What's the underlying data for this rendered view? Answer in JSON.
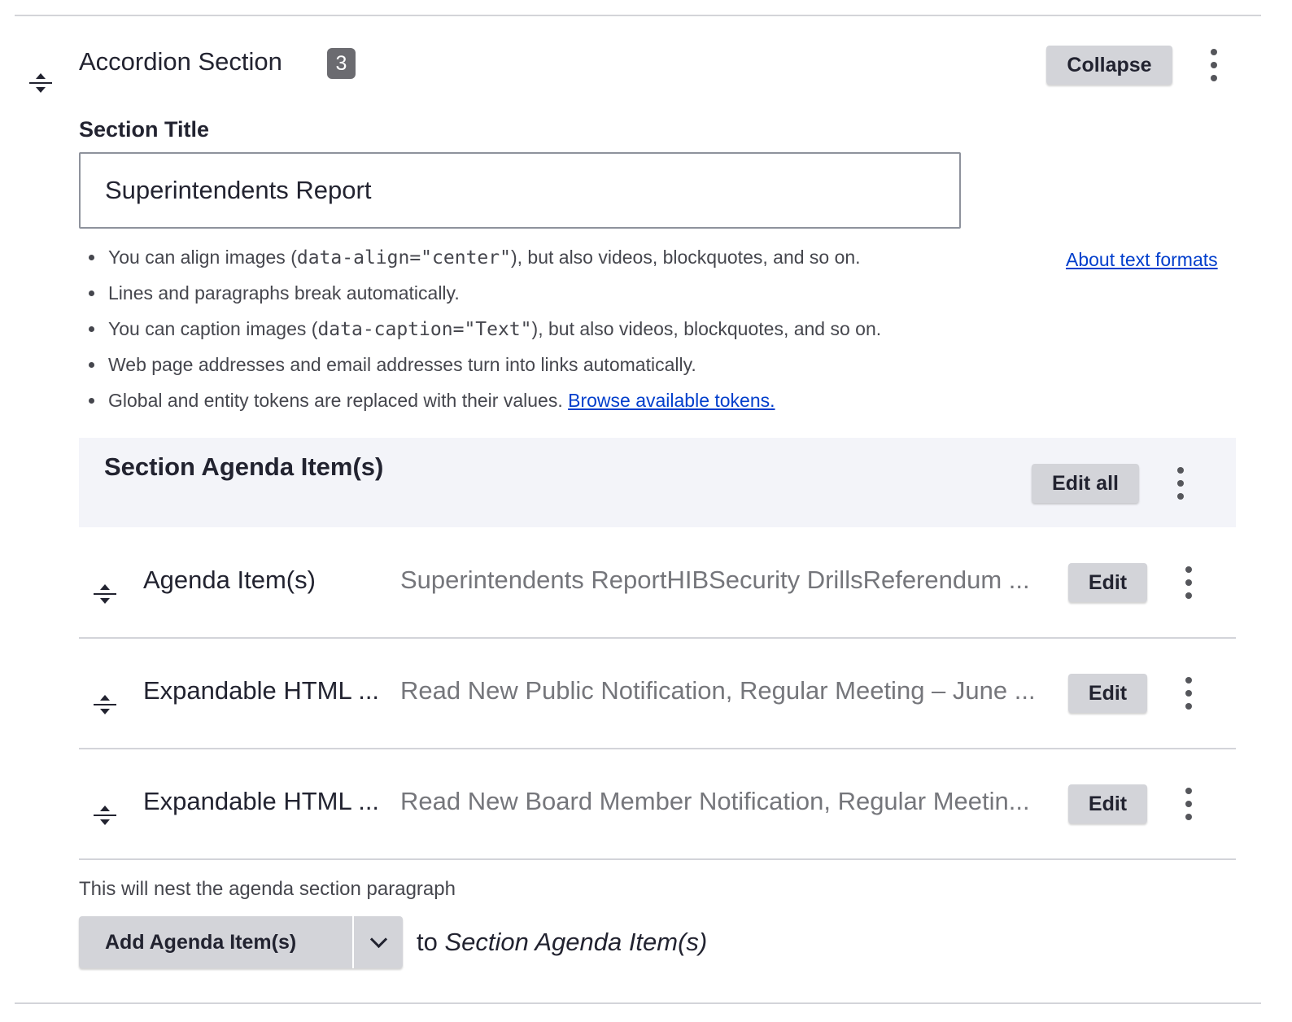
{
  "section": {
    "title": "Accordion Section",
    "count": "3",
    "collapse_label": "Collapse"
  },
  "section_title": {
    "label": "Section Title",
    "value": "Superintendents Report"
  },
  "format_tips": {
    "tip1_prefix": "You can align images (",
    "tip1_code": "data-align=\"center\"",
    "tip1_suffix": "), but also videos, blockquotes, and so on.",
    "tip2": "Lines and paragraphs break automatically.",
    "tip3_prefix": "You can caption images (",
    "tip3_code": "data-caption=\"Text\"",
    "tip3_suffix": "), but also videos, blockquotes, and so on.",
    "tip4": "Web page addresses and email addresses turn into links automatically.",
    "tip5_prefix": "Global and entity tokens are replaced with their values. ",
    "tip5_link": "Browse available tokens.",
    "about_link": "About text formats"
  },
  "agenda": {
    "heading": "Section Agenda Item(s)",
    "edit_all_label": "Edit all",
    "items": [
      {
        "name": "Agenda Item(s)",
        "summary": "Superintendents ReportHIBSecurity DrillsReferendum ...",
        "edit_label": "Edit"
      },
      {
        "name": "Expandable HTML ...",
        "summary": "Read New Public Notification, Regular Meeting – June ...",
        "edit_label": "Edit"
      },
      {
        "name": "Expandable HTML ...",
        "summary": "Read New Board Member Notification, Regular Meetin...",
        "edit_label": "Edit"
      }
    ]
  },
  "footer": {
    "help_text": "This will nest the agenda section paragraph",
    "add_label": "Add Agenda Item(s)",
    "to_prefix": "to ",
    "to_target": "Section Agenda Item(s)"
  },
  "colors": {
    "link": "#003ecc",
    "button_bg": "#d3d4d9",
    "header_bg": "#f3f4f9",
    "badge_bg": "#6b6b70"
  }
}
